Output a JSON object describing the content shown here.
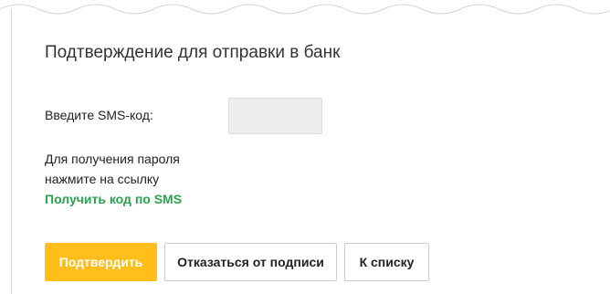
{
  "title": "Подтверждение для отправки в банк",
  "sms_code": {
    "label": "Введите SMS-код:",
    "value": ""
  },
  "hint": {
    "line1": "Для получения пароля",
    "line2": "нажмите на ссылку",
    "link": "Получить код по SMS"
  },
  "buttons": {
    "confirm": "Подтвердить",
    "refuse": "Отказаться от подписи",
    "to_list": "К списку"
  },
  "colors": {
    "accent_button": "#ffbe1a",
    "link": "#2aa150"
  }
}
